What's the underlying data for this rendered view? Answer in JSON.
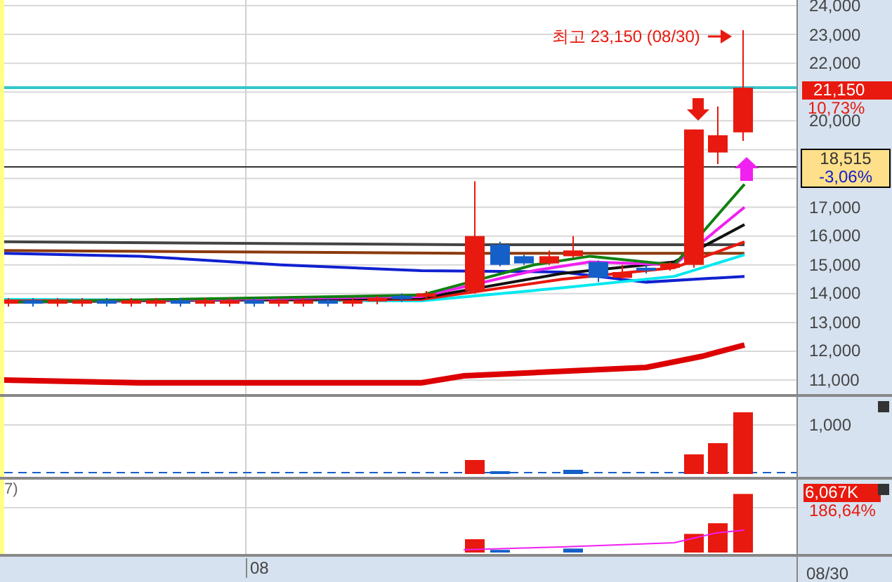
{
  "price_panel": {
    "annotation": "최고 23,150 (08/30)",
    "y_axis": [
      "24,000",
      "23,000",
      "22,000",
      "20,000",
      "17,000",
      "16,000",
      "15,000",
      "14,000",
      "13,000",
      "12,000",
      "11,000"
    ],
    "last_price": {
      "value": "21,150",
      "change": "10,73%"
    },
    "crosshair": {
      "value": "18,515",
      "change": "-3,06%"
    }
  },
  "volume_panel": {
    "y_axis": [
      "1,000"
    ]
  },
  "indicator_panel": {
    "label": "7)",
    "value": "6,067K",
    "change": "186,64%"
  },
  "x_axis": [
    "08",
    "08/30"
  ]
}
